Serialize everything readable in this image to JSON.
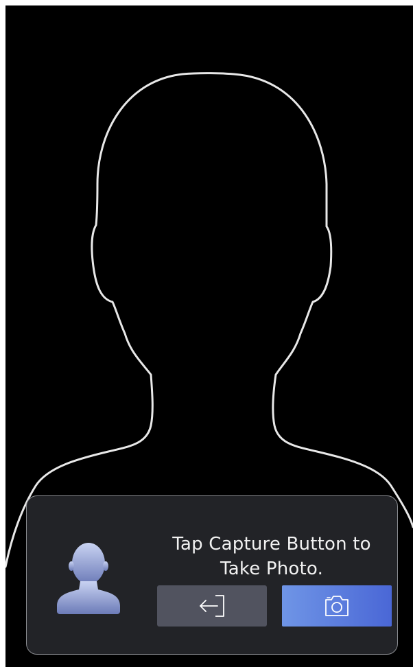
{
  "prompt": {
    "line1": "Tap Capture Button to",
    "line2": "Take Photo."
  },
  "icons": {
    "avatar": "person-avatar-icon",
    "back": "exit-arrow-icon",
    "capture": "camera-icon"
  },
  "colors": {
    "background": "#000000",
    "outline": "#e8e8e8",
    "panel": "#222327",
    "back_button": "#51535f",
    "capture_gradient_start": "#6f95e6",
    "capture_gradient_end": "#4a67d6",
    "text": "#f2f2f2"
  }
}
